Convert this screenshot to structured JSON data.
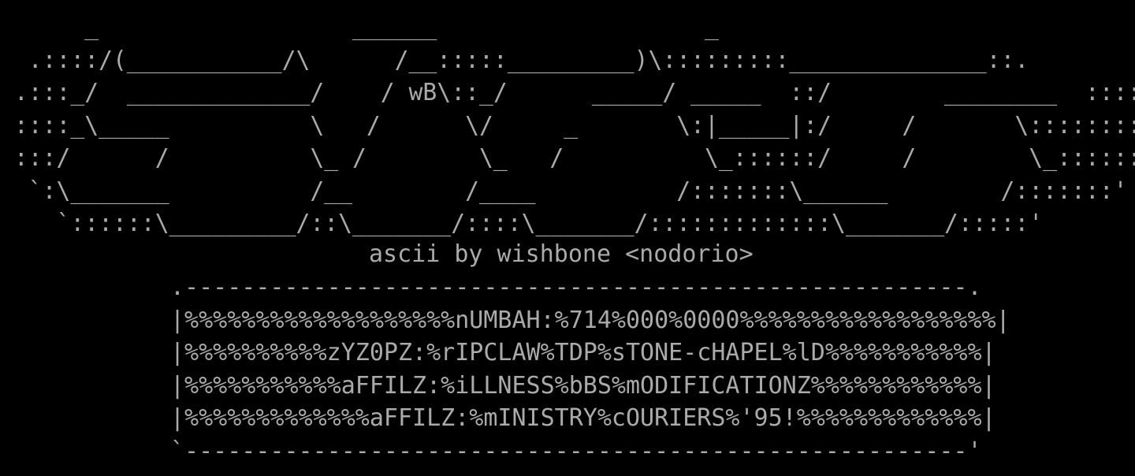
{
  "logo": {
    "lines": [
      "      _                  ______                   _",
      "  .::::/(___________/\\      /__:::::_________)\\:::::::::______________::.",
      " .:::_/  _____________/    / wB\\::_/      _____/ _____  ::/        ________  ::::::.",
      " ::::_\\_____          \\   /      \\/     _       \\:|_____|:/     /       \\:::::::::",
      " :::/      /          \\_ /        \\_   /          \\_::::::/     /        \\_::::::::",
      "  `:\\_______          /__        /____          /:::::::\\______        /:::::::'",
      "    `::::::\\_________/::\\_______/::::\\_______/:::::::::::::\\_______/:::::'"
    ]
  },
  "credit": "ascii by wishbone <nodorio>",
  "info_box": {
    "top_border": ".-------------------------------------------------------.",
    "rows": [
      "|%%%%%%%%%%%%%%%%%%%nUMBAH:%714%000%0000%%%%%%%%%%%%%%%%%%|",
      "|%%%%%%%%%%zYZ0PZ:%rIPCLAW%TDP%sTONE-cHAPEL%lD%%%%%%%%%%%|",
      "|%%%%%%%%%%%aFFILZ:%iLLNESS%bBS%mODIFICATIONZ%%%%%%%%%%%%|",
      "|%%%%%%%%%%%%%aFFILZ:%mINISTRY%cOURIERS%'95!%%%%%%%%%%%%%|"
    ],
    "bottom_border": "`-------------------------------------------------------'"
  },
  "colors": {
    "background": "#000000",
    "text": "#aaaaaa"
  }
}
